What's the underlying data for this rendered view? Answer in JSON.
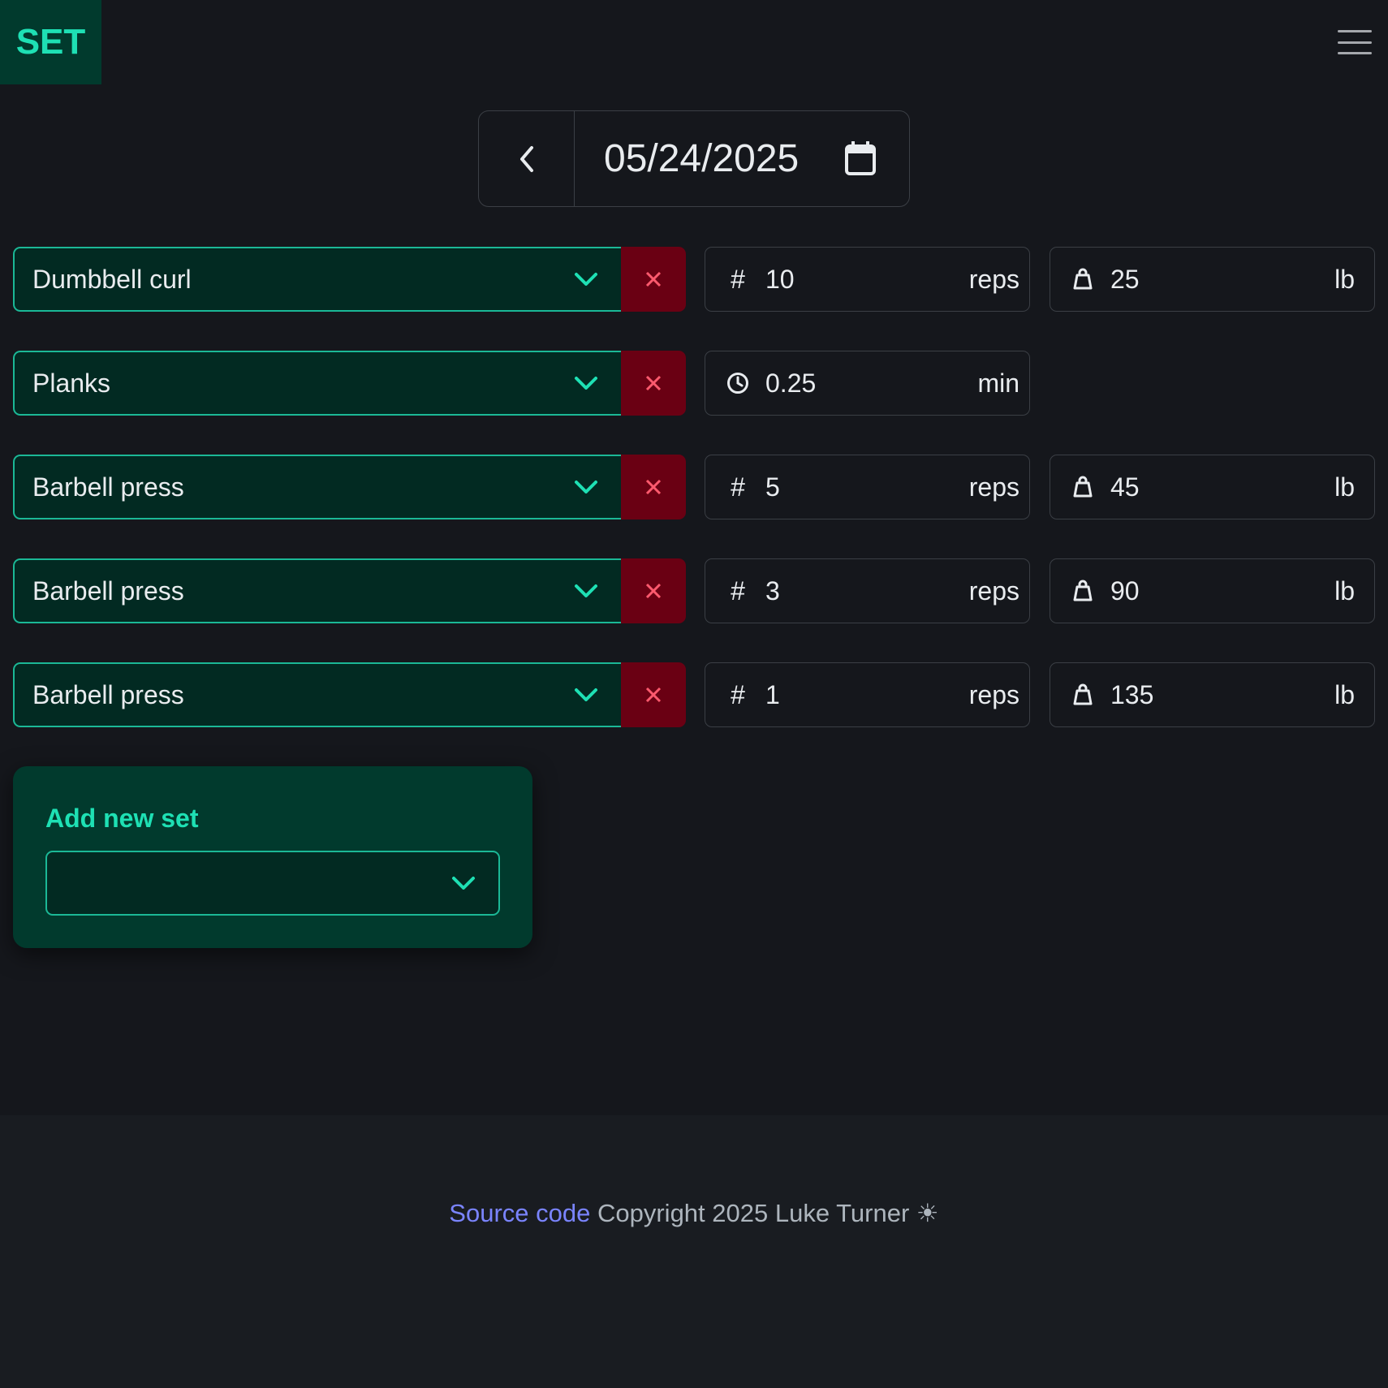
{
  "header": {
    "brand": "SET"
  },
  "date_nav": {
    "date": "05/24/2025"
  },
  "sets": [
    {
      "exercise": "Dumbbell curl",
      "metric_icon": "hash",
      "metric_value": "10",
      "metric_unit": "reps",
      "weight_value": "25",
      "weight_unit": "lb"
    },
    {
      "exercise": "Planks",
      "metric_icon": "clock",
      "metric_value": "0.25",
      "metric_unit": "min"
    },
    {
      "exercise": "Barbell press",
      "metric_icon": "hash",
      "metric_value": "5",
      "metric_unit": "reps",
      "weight_value": "45",
      "weight_unit": "lb"
    },
    {
      "exercise": "Barbell press",
      "metric_icon": "hash",
      "metric_value": "3",
      "metric_unit": "reps",
      "weight_value": "90",
      "weight_unit": "lb"
    },
    {
      "exercise": "Barbell press",
      "metric_icon": "hash",
      "metric_value": "1",
      "metric_unit": "reps",
      "weight_value": "135",
      "weight_unit": "lb"
    }
  ],
  "add_set": {
    "title": "Add new set",
    "selected": ""
  },
  "footer": {
    "source_link": "Source code",
    "copyright": "Copyright 2025 Luke Turner",
    "theme_icon": "☀"
  },
  "colors": {
    "accent": "#1ee0b4",
    "delete_bg": "#6a0013",
    "delete_icon": "#ff5a6e",
    "link": "#7a84ff"
  }
}
